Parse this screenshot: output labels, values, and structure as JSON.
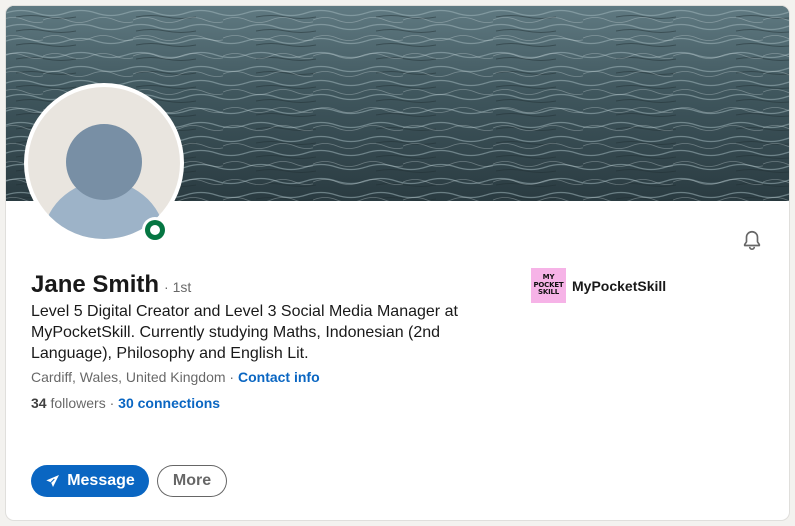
{
  "profile": {
    "name": "Jane Smith",
    "degree": "· 1st",
    "headline": "Level 5 Digital Creator and Level 3 Social Media Manager at MyPocketSkill. Currently studying Maths, Indonesian (2nd Language), Philosophy and English Lit.",
    "location": "Cardiff, Wales, United Kingdom",
    "separator": " · ",
    "contact_info_label": "Contact info",
    "followers_count": "34",
    "followers_label": " followers",
    "connections_prefix": " · ",
    "connections_label": "30 connections",
    "online_status_color": "#057642"
  },
  "company": {
    "name": "MyPocketSkill",
    "logo_lines": [
      "MY",
      "POCKET",
      "SKILL"
    ],
    "logo_bg": "#f6b3e7"
  },
  "actions": {
    "message_label": "Message",
    "more_label": "More"
  },
  "icons": {
    "notify": "bell-icon",
    "message": "send-icon"
  },
  "colors": {
    "accent": "#0a66c2",
    "banner": "#3b4f56"
  }
}
